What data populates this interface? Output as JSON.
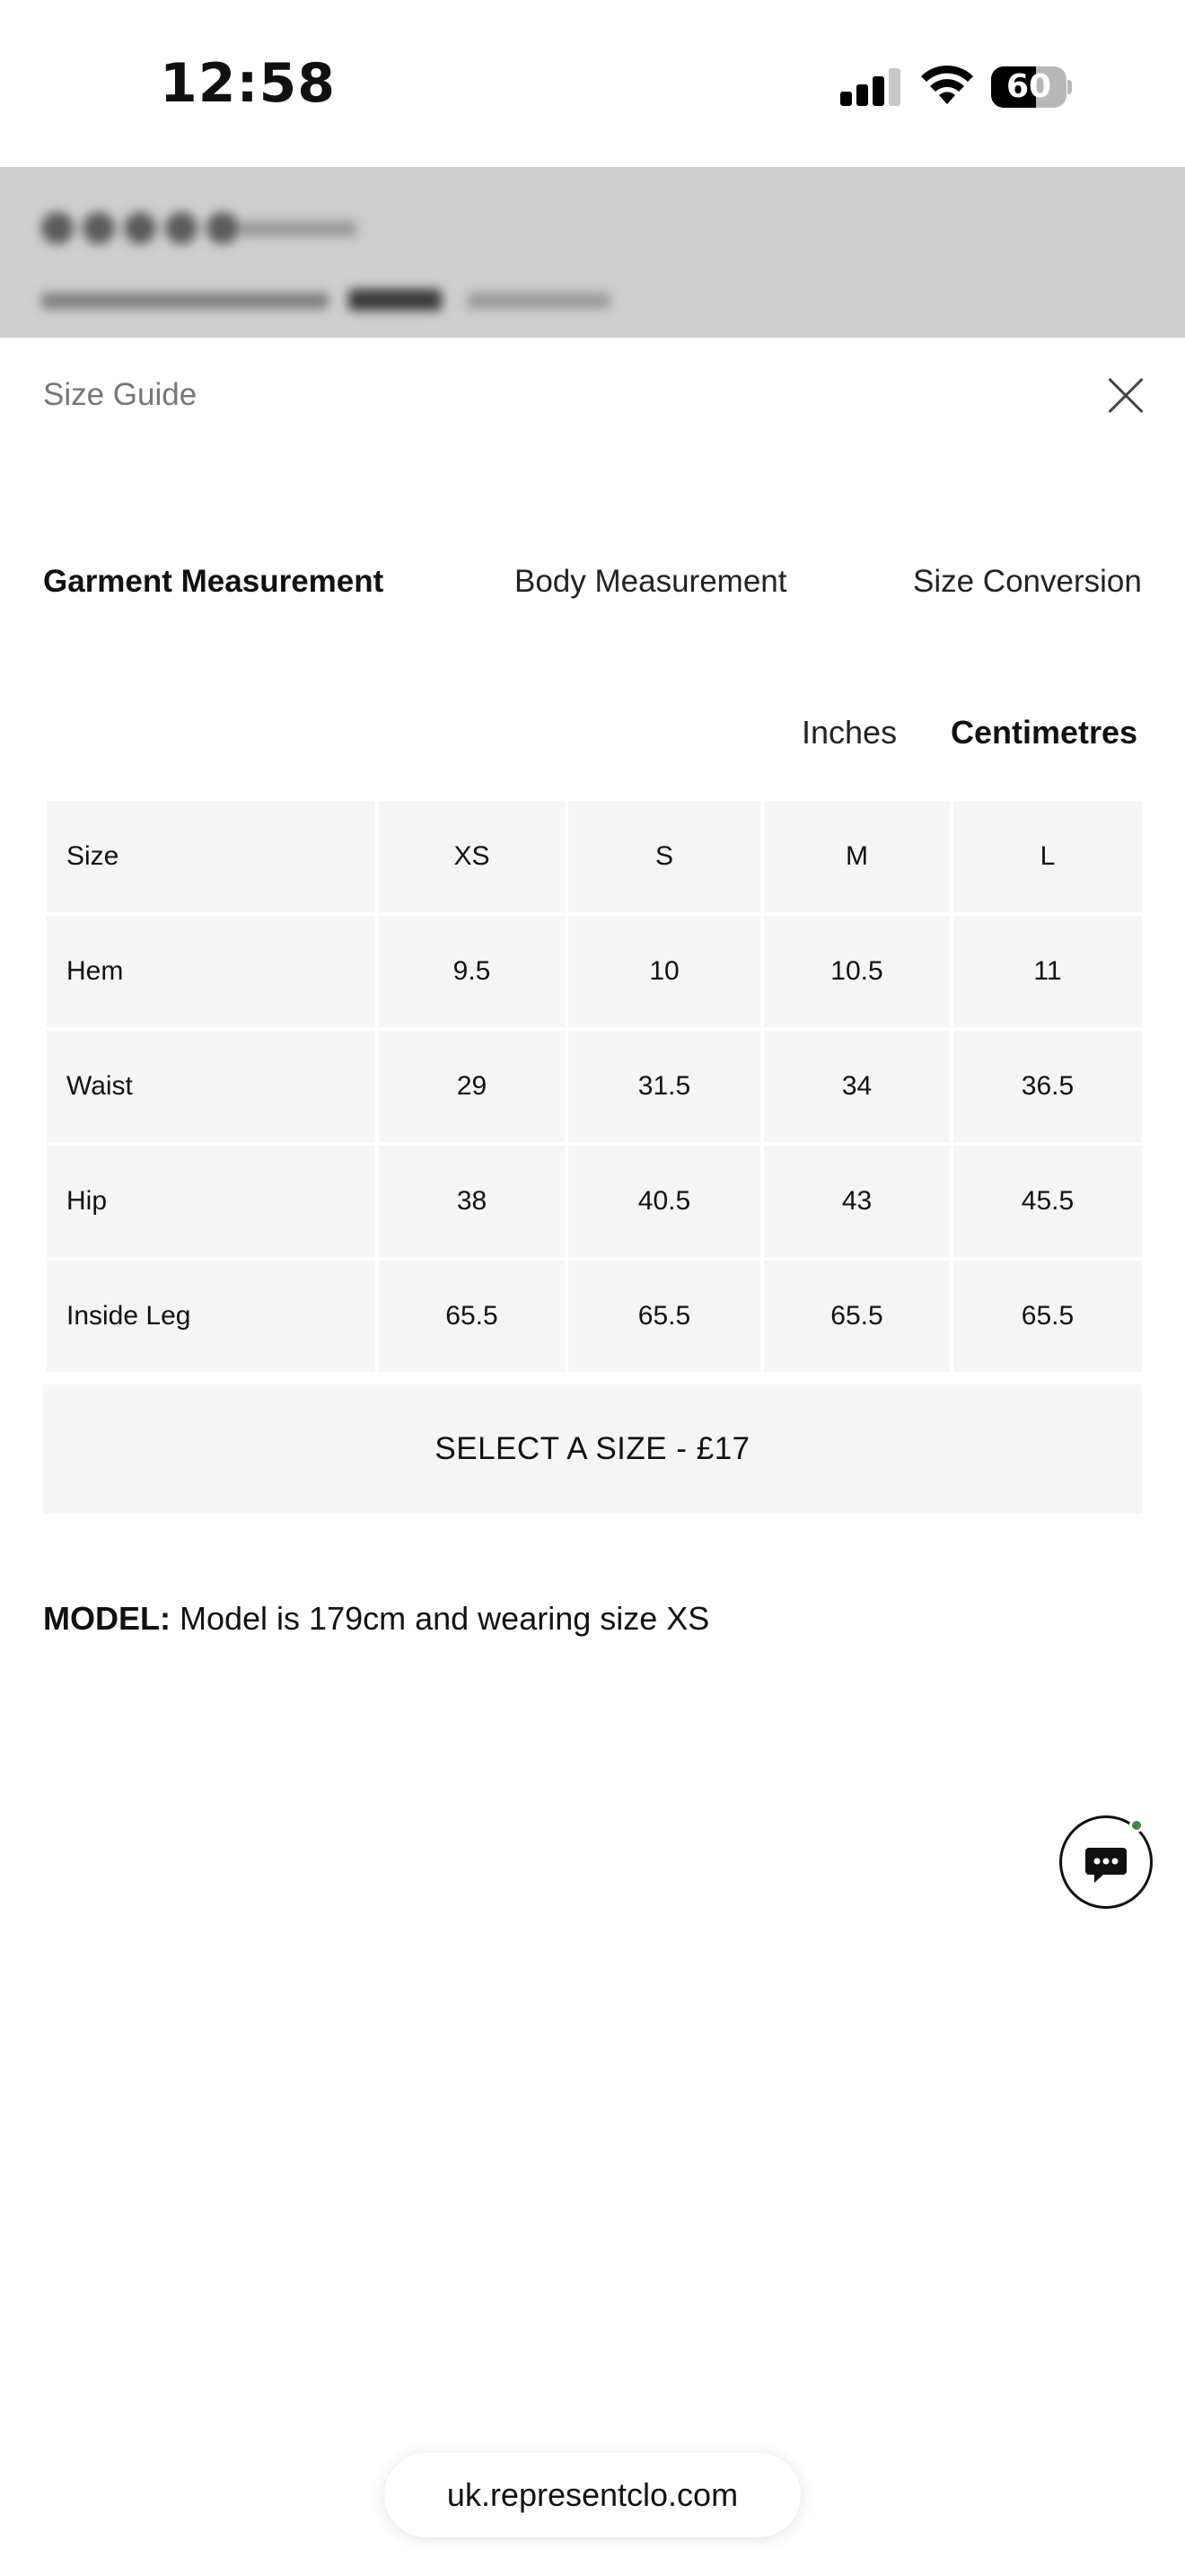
{
  "status_bar": {
    "time": "12:58",
    "battery_percent": "60",
    "battery_level": 0.6,
    "signal_bars_filled": 3,
    "signal_bars_total": 4
  },
  "sheet": {
    "title": "Size Guide"
  },
  "tabs": [
    {
      "label": "Garment Measurement",
      "active": true
    },
    {
      "label": "Body Measurement",
      "active": false
    },
    {
      "label": "Size Conversion",
      "active": false
    }
  ],
  "units": [
    {
      "label": "Inches",
      "active": false
    },
    {
      "label": "Centimetres",
      "active": true
    }
  ],
  "table": {
    "header": [
      "Size",
      "XS",
      "S",
      "M",
      "L"
    ],
    "rows": [
      [
        "Hem",
        "9.5",
        "10",
        "10.5",
        "11"
      ],
      [
        "Waist",
        "29",
        "31.5",
        "34",
        "36.5"
      ],
      [
        "Hip",
        "38",
        "40.5",
        "43",
        "45.5"
      ],
      [
        "Inside Leg",
        "65.5",
        "65.5",
        "65.5",
        "65.5"
      ]
    ]
  },
  "select_button": {
    "label": "SELECT A SIZE - £17"
  },
  "model_info": {
    "label": "MODEL:",
    "text": "Model is 179cm and wearing size XS"
  },
  "browser": {
    "url": "uk.representclo.com"
  },
  "colors": {
    "cell_background": "#f5f5f5",
    "backdrop": "#cfcfcf",
    "chat_status": "#3f8a3f"
  },
  "icons": {
    "close": "close-icon",
    "chat": "chat-bubble-icon",
    "signal": "cellular-signal-icon",
    "wifi": "wifi-icon",
    "battery": "battery-icon"
  }
}
